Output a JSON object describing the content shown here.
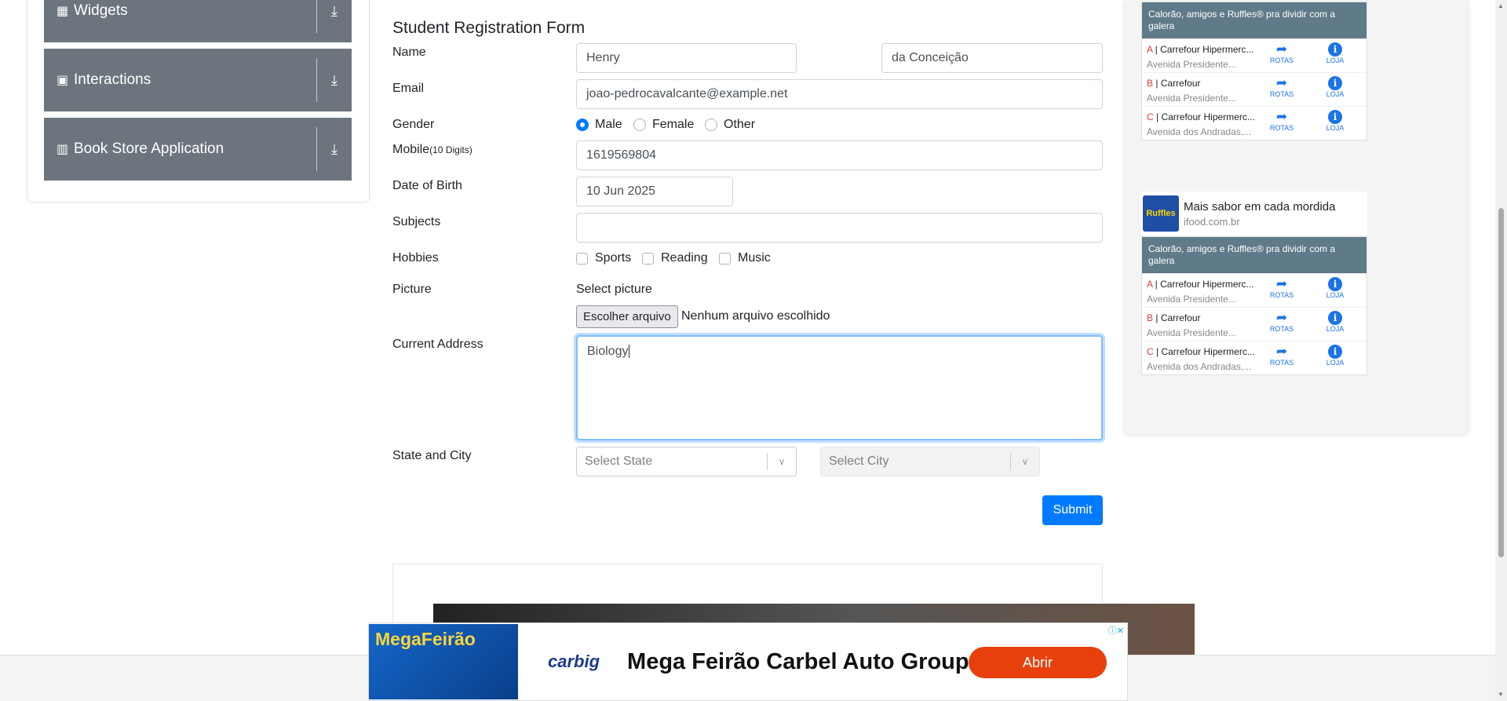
{
  "nav": {
    "groups": [
      {
        "label": "Widgets"
      },
      {
        "label": "Interactions"
      },
      {
        "label": "Book Store Application"
      }
    ]
  },
  "form": {
    "title": "Student Registration Form",
    "name_label": "Name",
    "first_name": "Henry",
    "last_name": "da Conceição",
    "email_label": "Email",
    "email": "joao-pedrocavalcante@example.net",
    "gender_label": "Gender",
    "gender_options": [
      "Male",
      "Female",
      "Other"
    ],
    "gender_selected": "Male",
    "mobile_label": "Mobile",
    "mobile_hint": "(10 Digits)",
    "mobile": "1619569804",
    "dob_label": "Date of Birth",
    "dob": "10 Jun 2025",
    "subjects_label": "Subjects",
    "subjects": "",
    "hobbies_label": "Hobbies",
    "hobbies": [
      "Sports",
      "Reading",
      "Music"
    ],
    "picture_label": "Picture",
    "select_picture": "Select picture",
    "file_button": "Escolher arquivo",
    "file_status": "Nenhum arquivo escolhido",
    "address_label": "Current Address",
    "address": "Biology",
    "state_city_label": "State and City",
    "state_placeholder": "Select State",
    "city_placeholder": "Select City",
    "submit": "Submit"
  },
  "ads": {
    "map_header": "Calorão, amigos e Ruffles® pra dividir com a galera",
    "stores": [
      {
        "letter": "A",
        "name": "Carrefour Hipermerc...",
        "addr": "Avenida Presidente..."
      },
      {
        "letter": "B",
        "name": "Carrefour",
        "addr": "Avenida Presidente..."
      },
      {
        "letter": "C",
        "name": "Carrefour Hipermerc...",
        "addr": "Avenida dos Andradas,..."
      }
    ],
    "rotas": "ROTAS",
    "loja": "LOJA",
    "ad2_title": "Mais sabor em cada mordida",
    "ad2_domain": "ifood.com.br",
    "banner_title": "Mega Feirão Carbel Auto Group",
    "banner_cta": "Abrir",
    "banner_logo": "carbig",
    "mega_a": "Mega",
    "mega_b": "Feirão"
  }
}
